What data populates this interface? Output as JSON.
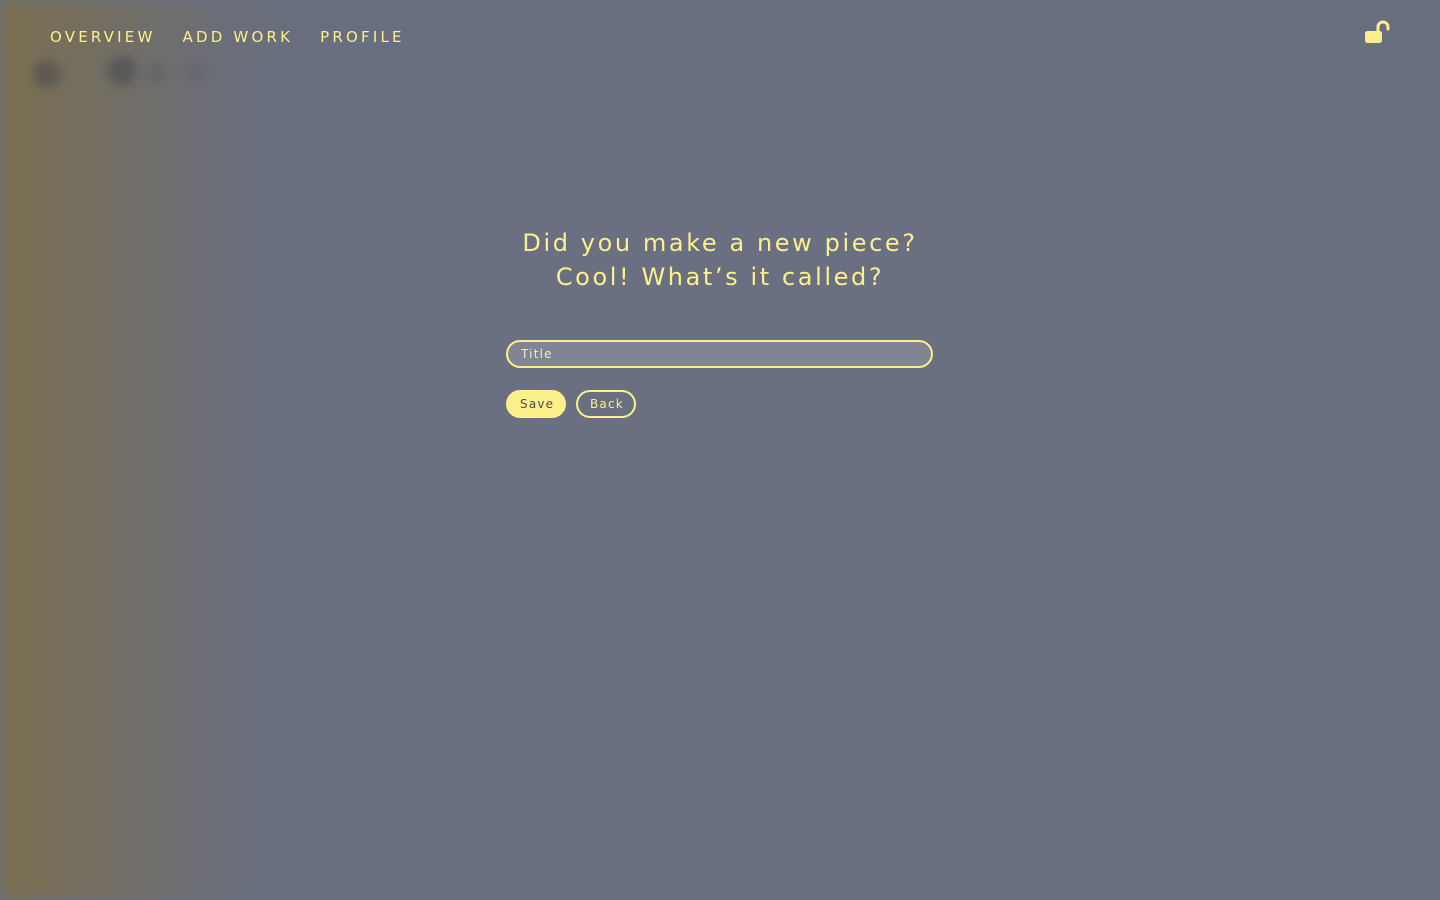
{
  "nav": {
    "items": [
      {
        "label": "OVERVIEW"
      },
      {
        "label": "ADD WORK"
      },
      {
        "label": "PROFILE"
      }
    ],
    "lock_icon": "unlocked-padlock-icon"
  },
  "form": {
    "heading_line1": "Did you make a new piece?",
    "heading_line2": "Cool! What’s it called?",
    "title_placeholder": "Title",
    "title_value": "",
    "save_label": "Save",
    "back_label": "Back"
  },
  "colors": {
    "accent": "#fbf08a",
    "background": "#6a7082"
  }
}
